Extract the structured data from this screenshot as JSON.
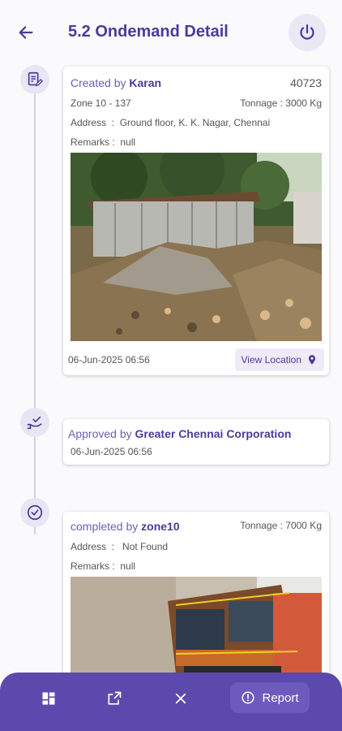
{
  "header": {
    "title": "5.2 Ondemand Detail"
  },
  "created": {
    "label": "Created by",
    "name": "Karan",
    "id": "40723",
    "zone": "Zone 10 - 137",
    "tonnage": "Tonnage : 3000 Kg",
    "address": "Address  :  Ground floor, K. K. Nagar, Chennai",
    "remarks": "Remarks :  null",
    "datetime": "06-Jun-2025 06:56",
    "view_location": "View Location"
  },
  "approved": {
    "label": "Approved by",
    "name": "Greater Chennai Corporation",
    "datetime": "06-Jun-2025 06:56"
  },
  "completed": {
    "label": "completed by",
    "name": "zone10",
    "tonnage": "Tonnage : 7000 Kg",
    "address": "Address  :   Not Found",
    "remarks": "Remarks :  null"
  },
  "bottom_bar": {
    "report_label": "Report"
  },
  "colors": {
    "primary": "#4b3a9c",
    "bar": "#5b49ad",
    "accent_bg": "#e8e5f5"
  },
  "icons": [
    "back-arrow-icon",
    "power-icon",
    "document-edit-icon",
    "hand-check-icon",
    "check-circle-icon",
    "location-pin-icon",
    "dashboard-icon",
    "open-external-icon",
    "close-icon",
    "alert-circle-icon"
  ]
}
